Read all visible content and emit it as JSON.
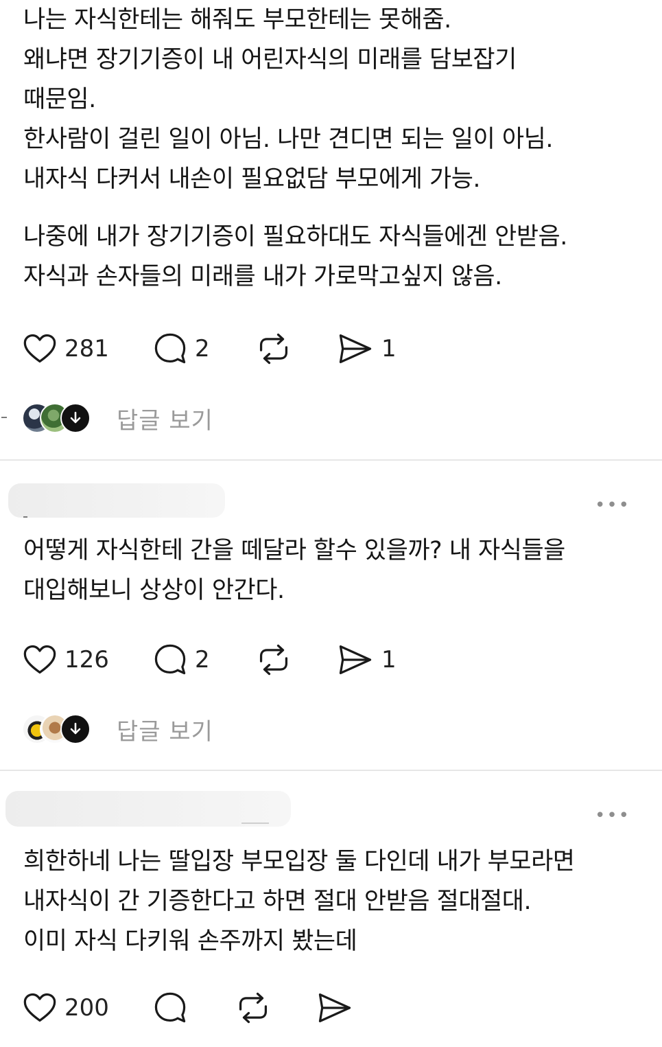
{
  "posts": [
    {
      "paragraphs": [
        [
          "나는 자식한테는 해줘도 부모한테는 못해줌.",
          "왜냐면 장기기증이 내 어린자식의 미래를 담보잡기",
          "때문임.",
          "한사람이 걸린 일이 아님. 나만 견디면 되는 일이 아님.",
          "내자식 다커서 내손이 필요없담 부모에게 가능."
        ],
        [
          "나중에 내가 장기기증이 필요하대도 자식들에겐 안받음.",
          "자식과 손자들의 미래를 내가 가로막고싶지 않음."
        ]
      ],
      "likes": "281",
      "comments": "2",
      "reposts": "",
      "shares": "1",
      "replies_label": "답글 보기"
    },
    {
      "paragraphs": [
        [
          "어떻게 자식한테 간을 떼달라 할수 있을까? 내 자식들을",
          "대입해보니 상상이 안간다."
        ]
      ],
      "likes": "126",
      "comments": "2",
      "reposts": "",
      "shares": "1",
      "replies_label": "답글 보기"
    },
    {
      "paragraphs": [
        [
          "희한하네 나는 딸입장 부모입장 둘 다인데 내가 부모라면",
          "내자식이 간 기증한다고 하면 절대 안받음 절대절대.",
          "이미 자식 다키워 손주까지 봤는데"
        ]
      ],
      "likes": "200",
      "comments": "",
      "reposts": "",
      "shares": ""
    }
  ],
  "icons": {
    "like": "heart-icon",
    "comment": "speech-bubble-icon",
    "repost": "repost-icon",
    "share": "send-icon",
    "more": "more-options-icon",
    "expand": "arrow-down-icon"
  },
  "colors": {
    "text": "#151515",
    "muted": "#9a9a9a",
    "divider": "#e6e6e6"
  }
}
